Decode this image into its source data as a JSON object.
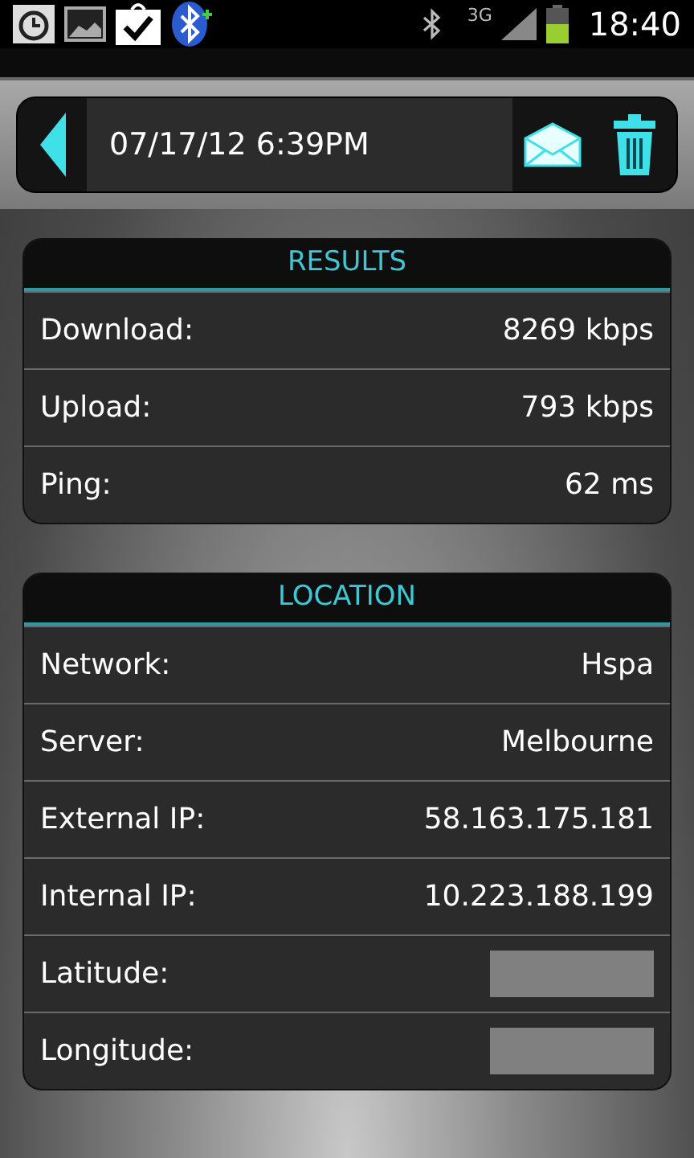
{
  "status_bar": {
    "time": "18:40",
    "network": "3G"
  },
  "toolbar": {
    "date": "07/17/12 6:39PM"
  },
  "sections": [
    {
      "title": "RESULTS",
      "rows": [
        {
          "kind": "text",
          "label": "Download:",
          "value": "8269 kbps"
        },
        {
          "kind": "text",
          "label": "Upload:",
          "value": "793 kbps"
        },
        {
          "kind": "text",
          "label": "Ping:",
          "value": "62 ms"
        }
      ]
    },
    {
      "title": "LOCATION",
      "rows": [
        {
          "kind": "text",
          "label": "Network:",
          "value": "Hspa"
        },
        {
          "kind": "text",
          "label": "Server:",
          "value": "Melbourne"
        },
        {
          "kind": "text",
          "label": "External IP:",
          "value": "58.163.175.181"
        },
        {
          "kind": "text",
          "label": "Internal IP:",
          "value": "10.223.188.199"
        },
        {
          "kind": "redacted",
          "label": "Latitude:"
        },
        {
          "kind": "redacted",
          "label": "Longitude:"
        }
      ]
    }
  ]
}
